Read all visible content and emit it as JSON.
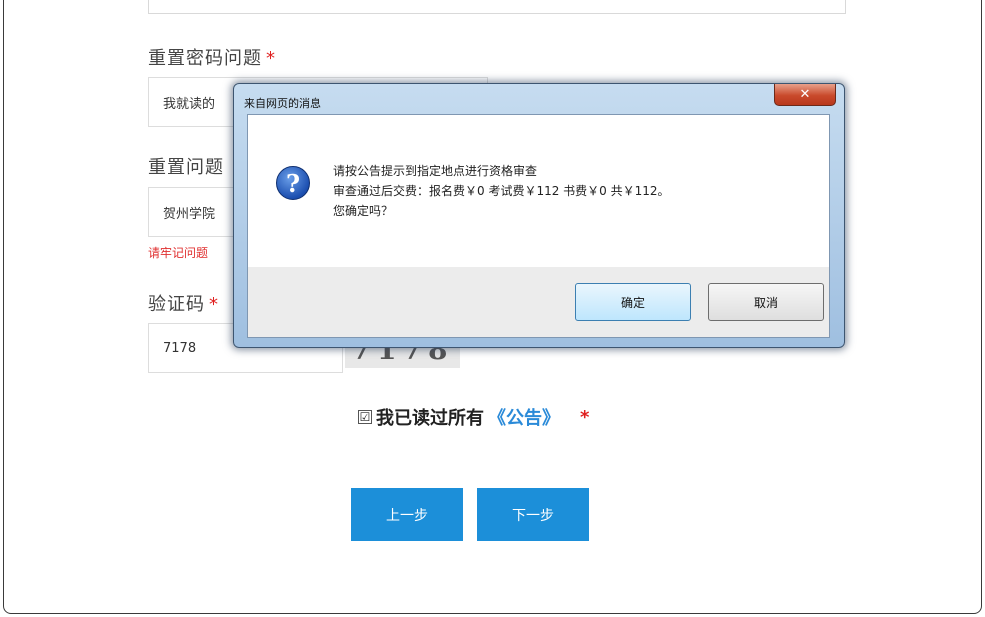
{
  "form": {
    "reset_question_label": "重置密码问题",
    "reset_question_value": "我就读的",
    "reset_answer_label": "重置问题",
    "reset_answer_value": "贺州学院",
    "hint": "请牢记问题",
    "captcha_label": "验证码",
    "captcha_value": "7178",
    "captcha_image_text": "7178",
    "required_mark": "*",
    "agree_check": "☑",
    "agree_text": "我已读过所有",
    "agree_link": "《公告》",
    "prev_button": "上一步",
    "next_button": "下一步"
  },
  "dialog": {
    "title": "来自网页的消息",
    "close_label": "✕",
    "icon_glyph": "?",
    "line1": "请按公告提示到指定地点进行资格审查",
    "line2": "审查通过后交费：报名费￥0 考试费￥112 书费￥0 共￥112。",
    "line3": "您确定吗？",
    "ok_label": "确定",
    "cancel_label": "取消"
  },
  "colors": {
    "primary_button": "#1c8fd9",
    "required": "#e02020",
    "link": "#2a8ad8"
  }
}
